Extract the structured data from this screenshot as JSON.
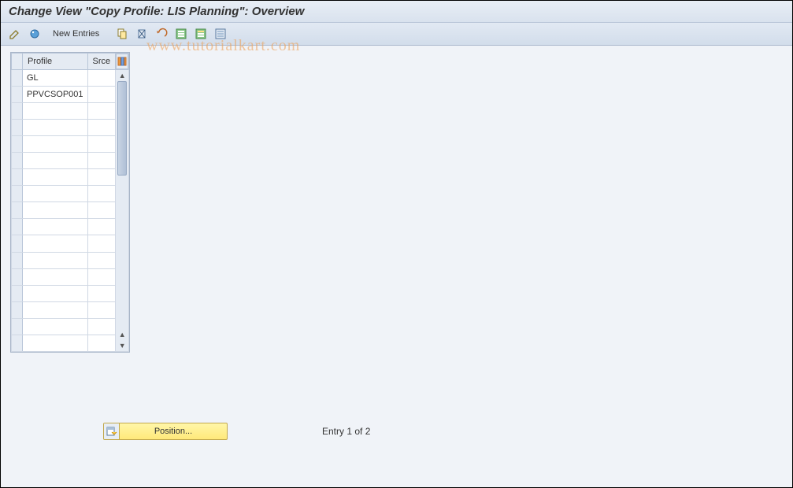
{
  "title": "Change View \"Copy Profile: LIS Planning\": Overview",
  "toolbar": {
    "new_entries": "New Entries"
  },
  "table": {
    "headers": {
      "profile": "Profile",
      "srce": "Srce"
    },
    "rows": [
      {
        "profile": "GL",
        "srce": ""
      },
      {
        "profile": "PPVCSOP001",
        "srce": ""
      },
      {
        "profile": "",
        "srce": ""
      },
      {
        "profile": "",
        "srce": ""
      },
      {
        "profile": "",
        "srce": ""
      },
      {
        "profile": "",
        "srce": ""
      },
      {
        "profile": "",
        "srce": ""
      },
      {
        "profile": "",
        "srce": ""
      },
      {
        "profile": "",
        "srce": ""
      },
      {
        "profile": "",
        "srce": ""
      },
      {
        "profile": "",
        "srce": ""
      },
      {
        "profile": "",
        "srce": ""
      },
      {
        "profile": "",
        "srce": ""
      },
      {
        "profile": "",
        "srce": ""
      },
      {
        "profile": "",
        "srce": ""
      },
      {
        "profile": "",
        "srce": ""
      },
      {
        "profile": "",
        "srce": ""
      }
    ]
  },
  "footer": {
    "position_label": "Position...",
    "entry_text": "Entry 1 of 2"
  },
  "watermark": "www.tutorialkart.com"
}
